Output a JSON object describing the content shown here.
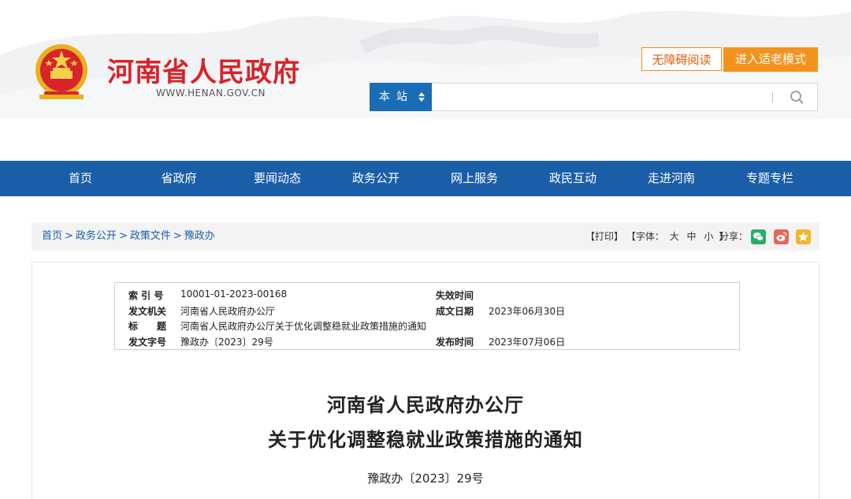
{
  "header": {
    "site_title": "河南省人民政府",
    "site_url": "WWW.HENAN.GOV.CN",
    "accessible_btn": "无障碍阅读",
    "elder_mode_btn": "进入适老模式",
    "search": {
      "scope_label": "本站",
      "placeholder": ""
    }
  },
  "nav": {
    "items": [
      "首页",
      "省政府",
      "要闻动态",
      "政务公开",
      "网上服务",
      "政民互动",
      "走进河南",
      "专题专栏"
    ]
  },
  "breadcrumb": {
    "items": [
      "首页",
      "政务公开",
      "政策文件",
      "豫政办"
    ],
    "separator": ">"
  },
  "tools": {
    "print": "【打印】",
    "font_label": "【字体：",
    "font_large": "大",
    "font_medium": "中",
    "font_small": "小",
    "font_end": "】",
    "share_label": "分享："
  },
  "meta": {
    "index_label": "索 引 号",
    "index_value": "10001-01-2023-00168",
    "expire_label": "失效时间",
    "expire_value": "",
    "issuer_label": "发文机关",
    "issuer_value": "河南省人民政府办公厅",
    "date_label": "成文日期",
    "date_value": "2023年06月30日",
    "title_label": "标　　题",
    "title_value": "河南省人民政府办公厅关于优化调整稳就业政策措施的通知",
    "docno_label": "发文字号",
    "docno_value": "豫政办〔2023〕29号",
    "publish_label": "发布时间",
    "publish_value": "2023年07月06日"
  },
  "document": {
    "title_line1": "河南省人民政府办公厅",
    "title_line2": "关于优化调整稳就业政策措施的通知",
    "number": "豫政办〔2023〕29号"
  },
  "colors": {
    "brand_red": "#d8232a",
    "nav_blue": "#1b5ea8",
    "search_blue": "#1a6db5",
    "orange": "#f3931e",
    "wechat_green": "#2aae67",
    "weibo_red": "#e8655a",
    "favorite_yellow": "#f4b531"
  },
  "icons": {
    "emblem": "national-emblem-icon",
    "search": "magnifier-icon",
    "scope_toggle": "updown-arrow-icon",
    "share_wechat": "wechat-icon",
    "share_weibo": "weibo-icon",
    "share_favorite": "star-icon"
  }
}
